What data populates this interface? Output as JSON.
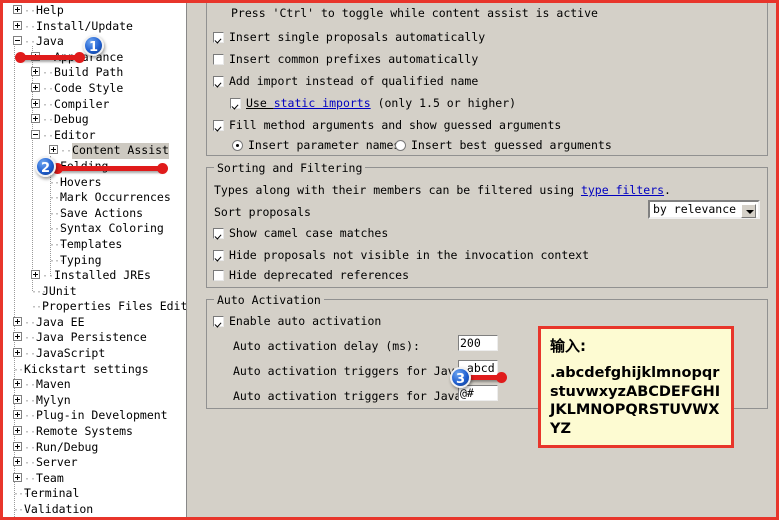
{
  "tree": {
    "items": [
      {
        "label": "Help",
        "indent": 0,
        "toggle": "plus"
      },
      {
        "label": "Install/Update",
        "indent": 0,
        "toggle": "plus"
      },
      {
        "label": "Java",
        "indent": 0,
        "toggle": "minus"
      },
      {
        "label": "Appearance",
        "indent": 1,
        "toggle": "plus"
      },
      {
        "label": "Build Path",
        "indent": 1,
        "toggle": "plus"
      },
      {
        "label": "Code Style",
        "indent": 1,
        "toggle": "plus"
      },
      {
        "label": "Compiler",
        "indent": 1,
        "toggle": "plus"
      },
      {
        "label": "Debug",
        "indent": 1,
        "toggle": "plus"
      },
      {
        "label": "Editor",
        "indent": 1,
        "toggle": "minus"
      },
      {
        "label": "Content Assist",
        "indent": 2,
        "toggle": "plus",
        "selected": true
      },
      {
        "label": "Folding",
        "indent": 2,
        "toggle": "none"
      },
      {
        "label": "Hovers",
        "indent": 2,
        "toggle": "none"
      },
      {
        "label": "Mark Occurrences",
        "indent": 2,
        "toggle": "none"
      },
      {
        "label": "Save Actions",
        "indent": 2,
        "toggle": "none"
      },
      {
        "label": "Syntax Coloring",
        "indent": 2,
        "toggle": "none"
      },
      {
        "label": "Templates",
        "indent": 2,
        "toggle": "none"
      },
      {
        "label": "Typing",
        "indent": 2,
        "toggle": "none"
      },
      {
        "label": "Installed JREs",
        "indent": 1,
        "toggle": "plus"
      },
      {
        "label": "JUnit",
        "indent": 1,
        "toggle": "none"
      },
      {
        "label": "Properties Files Edit",
        "indent": 1,
        "toggle": "none"
      },
      {
        "label": "Java EE",
        "indent": 0,
        "toggle": "plus"
      },
      {
        "label": "Java Persistence",
        "indent": 0,
        "toggle": "plus"
      },
      {
        "label": "JavaScript",
        "indent": 0,
        "toggle": "plus"
      },
      {
        "label": "Kickstart settings",
        "indent": 0,
        "toggle": "none"
      },
      {
        "label": "Maven",
        "indent": 0,
        "toggle": "plus"
      },
      {
        "label": "Mylyn",
        "indent": 0,
        "toggle": "plus"
      },
      {
        "label": "Plug-in Development",
        "indent": 0,
        "toggle": "plus"
      },
      {
        "label": "Remote Systems",
        "indent": 0,
        "toggle": "plus"
      },
      {
        "label": "Run/Debug",
        "indent": 0,
        "toggle": "plus"
      },
      {
        "label": "Server",
        "indent": 0,
        "toggle": "plus"
      },
      {
        "label": "Team",
        "indent": 0,
        "toggle": "plus"
      },
      {
        "label": "Terminal",
        "indent": 0,
        "toggle": "none"
      },
      {
        "label": "Validation",
        "indent": 0,
        "toggle": "none"
      }
    ]
  },
  "insertion": {
    "hint": "Press 'Ctrl' to toggle while content assist is active",
    "insert_single": "Insert single proposals automatically",
    "insert_common": "Insert common prefixes automatically",
    "add_import": "Add import instead of qualified name",
    "use_static_pre": "Use ",
    "use_static_link": "static imports",
    "use_static_post": " (only 1.5 or higher)",
    "fill_method": "Fill method arguments and show guessed arguments",
    "radio_param_names": "Insert parameter names",
    "radio_best_guessed": "Insert best guessed arguments"
  },
  "sorting": {
    "legend": "Sorting and Filtering",
    "desc_pre": "Types along with their members can be filtered using ",
    "desc_link": "type filters",
    "desc_post": ".",
    "sort_label": "Sort proposals",
    "sort_value": "by relevance",
    "camel_case": "Show camel case matches",
    "hide_not_visible": "Hide proposals not visible in the invocation context",
    "hide_deprecated": "Hide deprecated references"
  },
  "auto_activation": {
    "legend": "Auto Activation",
    "enable": "Enable auto activation",
    "delay_label": "Auto activation delay (ms):",
    "delay_value": "200",
    "java_label": "Auto activation triggers for Java:",
    "java_value": ".abcd",
    "javadoc_label": "Auto activation triggers for Javadoc:",
    "javadoc_value": "@#"
  },
  "annotations": {
    "badge1": "1",
    "badge2": "2",
    "badge3": "3",
    "callout_title": "输入:",
    "callout_body": ".abcdefghijklmnopqrstuvwxyzABCDEFGHIJKLMNOPQRSTUVWXYZ",
    "accent_color": "#e8352b",
    "badge_color": "#1f5fd0"
  }
}
